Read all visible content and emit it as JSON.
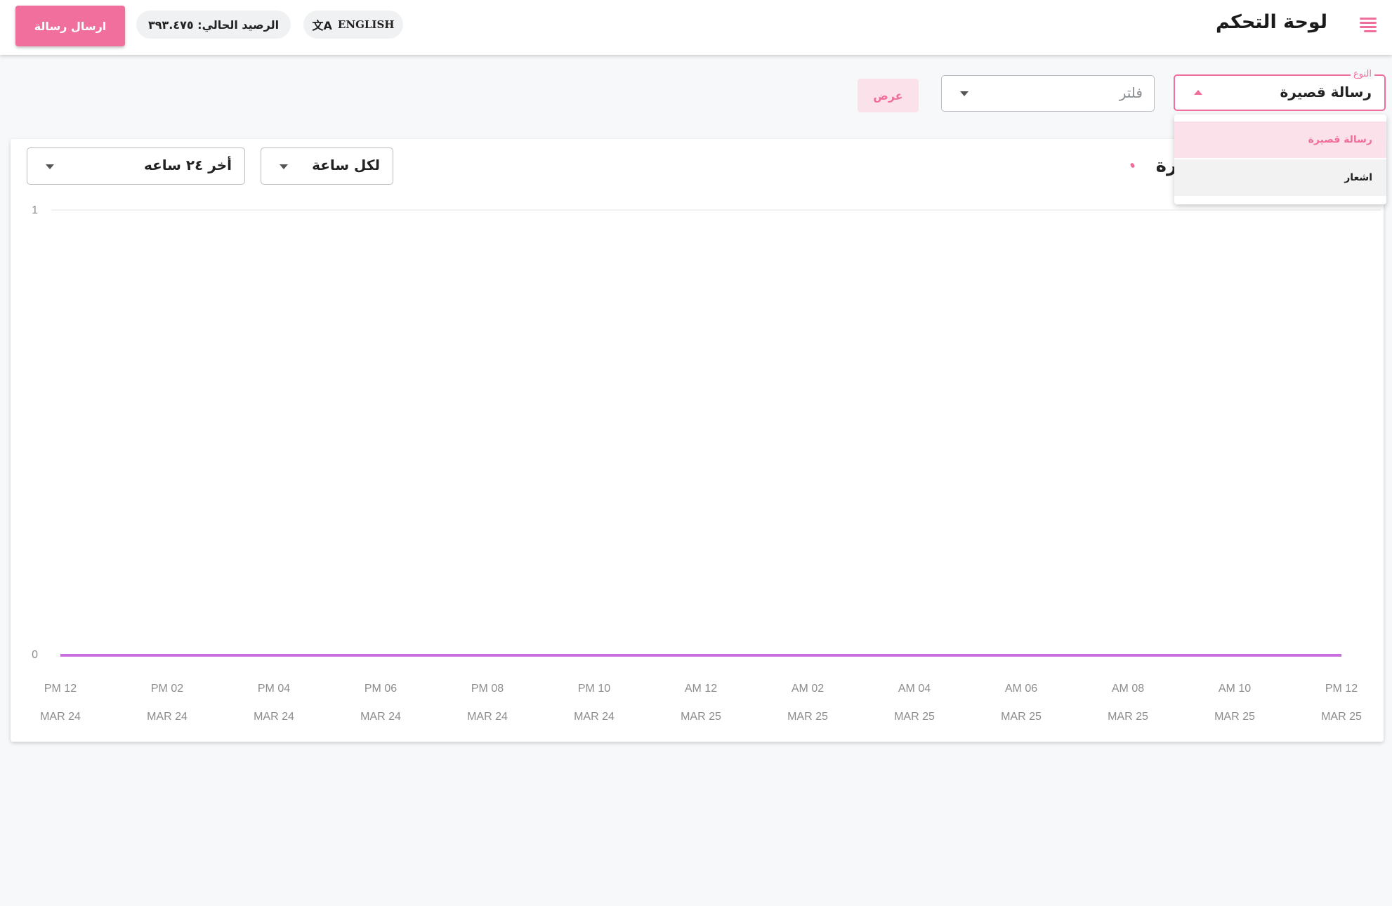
{
  "header": {
    "title": "لوحة التحكم",
    "language_label": "ENGLISH",
    "balance_label": "الرصيد الحالي: ٣٩٣.٤٧٥",
    "send_button": "ارسال رسالة"
  },
  "filters": {
    "type_label": "النوع",
    "type_value": "رسالة قصيرة",
    "type_options": [
      "رسالة قصيرة",
      "اشعار"
    ],
    "filter_placeholder": "فلتر",
    "view_button": "عرض"
  },
  "chart_card": {
    "title": "رة",
    "interval_value": "لكل ساعة",
    "range_value": "أخر ٢٤ ساعه"
  },
  "colors": {
    "accent": "#ef6f9c",
    "series_line": "#c86de0"
  },
  "chart_data": {
    "type": "line",
    "x_labels": [
      [
        "PM 12",
        "MAR 24"
      ],
      [
        "PM 02",
        "MAR 24"
      ],
      [
        "PM 04",
        "MAR 24"
      ],
      [
        "PM 06",
        "MAR 24"
      ],
      [
        "PM 08",
        "MAR 24"
      ],
      [
        "PM 10",
        "MAR 24"
      ],
      [
        "AM 12",
        "MAR 25"
      ],
      [
        "AM 02",
        "MAR 25"
      ],
      [
        "AM 04",
        "MAR 25"
      ],
      [
        "AM 06",
        "MAR 25"
      ],
      [
        "AM 08",
        "MAR 25"
      ],
      [
        "AM 10",
        "MAR 25"
      ],
      [
        "PM 12",
        "MAR 25"
      ]
    ],
    "y_ticks": [
      0,
      1
    ],
    "ylim": [
      0,
      1
    ],
    "series": [
      {
        "values": [
          0,
          0,
          0,
          0,
          0,
          0,
          0,
          0,
          0,
          0,
          0,
          0,
          0
        ]
      }
    ]
  }
}
